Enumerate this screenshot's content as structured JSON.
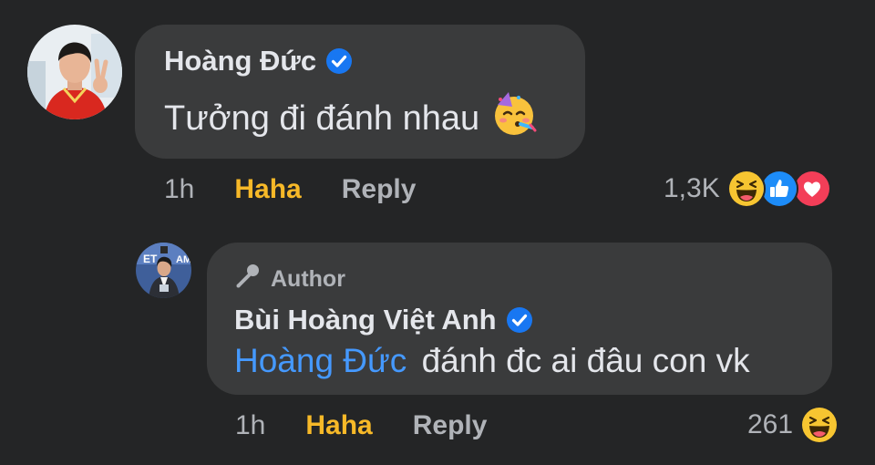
{
  "comment": {
    "author": "Hoàng Đức",
    "text": "Tưởng đi đánh nhau",
    "text_emoji_icon": "partying-face-icon",
    "time": "1h",
    "reaction_label": "Haha",
    "reply_label": "Reply",
    "reaction_count": "1,3K",
    "reaction_icons": [
      "haha-icon",
      "like-icon",
      "love-icon"
    ]
  },
  "reply": {
    "badge_label": "Author",
    "author": "Bùi Hoàng Việt Anh",
    "mention": "Hoàng Đức",
    "text": "đánh đc ai đâu con vk",
    "time": "1h",
    "reaction_label": "Haha",
    "reply_label": "Reply",
    "reaction_count": "261",
    "reaction_icons": [
      "haha-icon"
    ]
  },
  "colors": {
    "background": "#242526",
    "bubble": "#3a3b3c",
    "text": "#e4e6eb",
    "muted": "#b0b3b8",
    "haha_accent": "#f7b928",
    "mention": "#4599ff",
    "verified": "#1877f2"
  }
}
